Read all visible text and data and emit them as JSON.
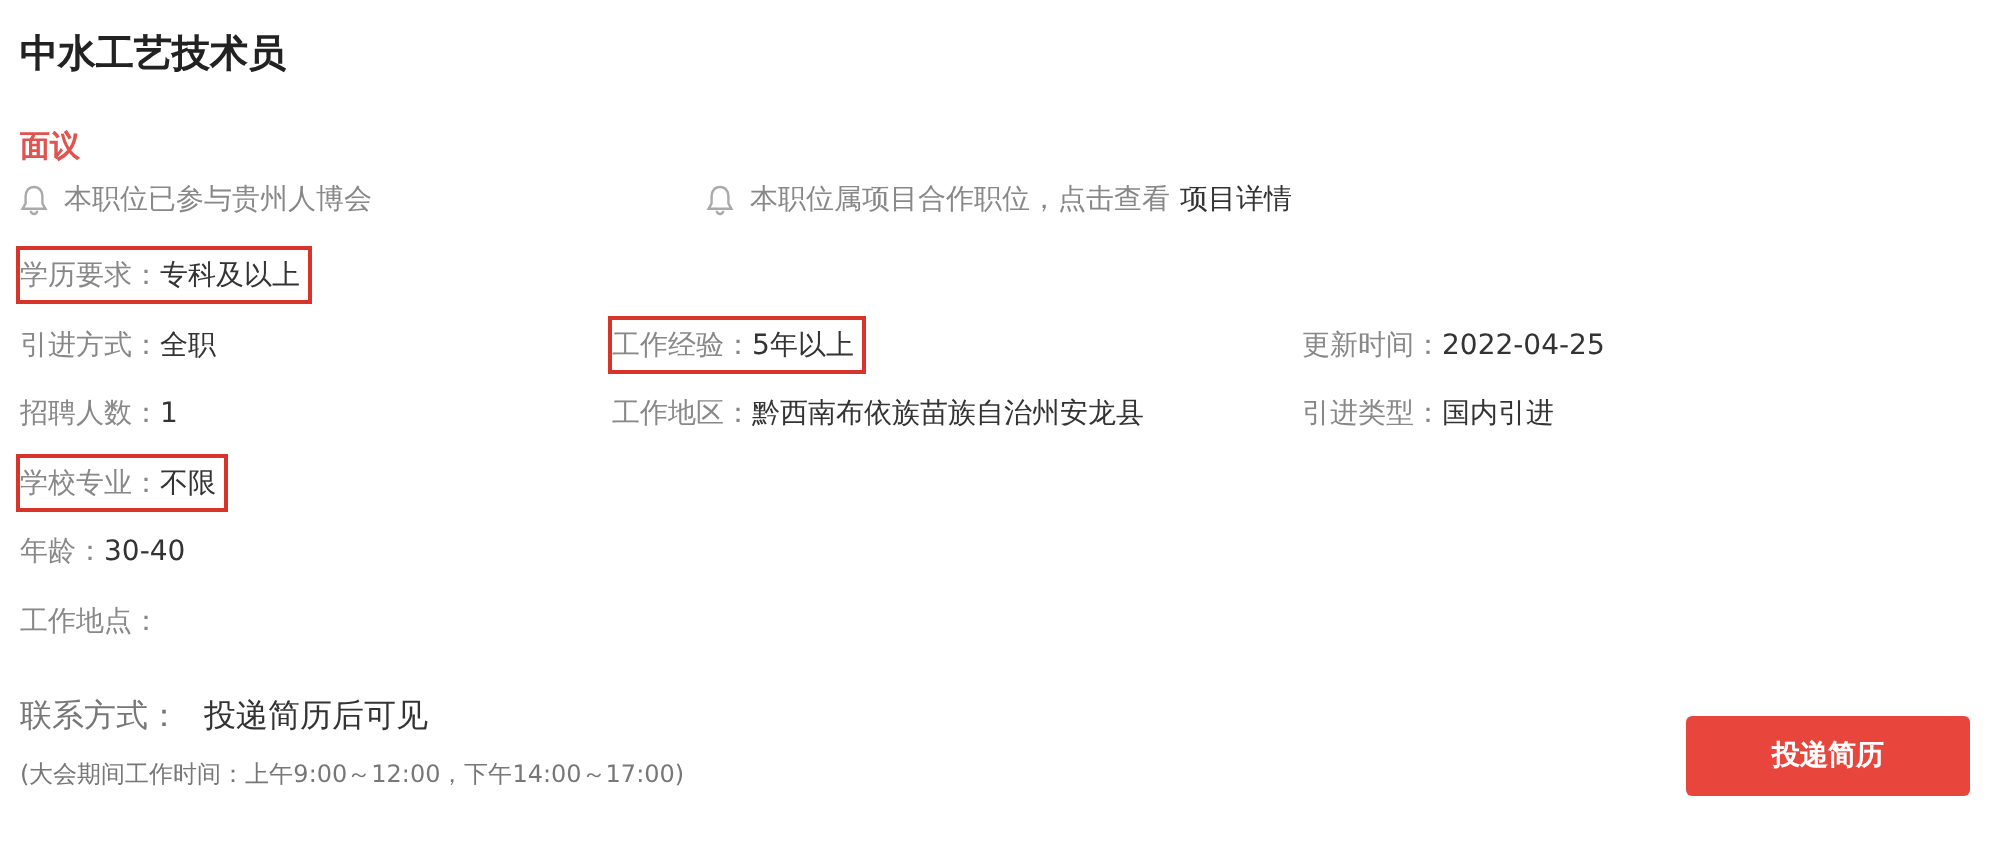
{
  "title": "中水工艺技术员",
  "salary": "面议",
  "notices": [
    {
      "text": "本职位已参与贵州人博会"
    },
    {
      "text": "本职位属项目合作职位，点击查看",
      "link": "项目详情"
    }
  ],
  "fields": [
    [
      {
        "label": "学历要求：",
        "value": "专科及以上",
        "highlighted": true
      }
    ],
    [
      {
        "label": "引进方式：",
        "value": "全职",
        "highlighted": false
      },
      {
        "label": "工作经验：",
        "value": "5年以上",
        "highlighted": true
      },
      {
        "label": "更新时间：",
        "value": "2022-04-25",
        "highlighted": false
      }
    ],
    [
      {
        "label": "招聘人数：",
        "value": "1",
        "highlighted": false
      },
      {
        "label": "工作地区：",
        "value": "黔西南布依族苗族自治州安龙县",
        "highlighted": false
      },
      {
        "label": "引进类型：",
        "value": "国内引进",
        "highlighted": false
      }
    ],
    [
      {
        "label": "学校专业：",
        "value": "不限",
        "highlighted": true
      }
    ],
    [
      {
        "label": "年龄：",
        "value": "30-40",
        "highlighted": false
      }
    ],
    [
      {
        "label": "工作地点：",
        "highlighted": false
      }
    ]
  ],
  "contact": {
    "label": "联系方式：",
    "value": "投递简历后可见"
  },
  "hours": "(大会期间工作时间：上午9:00～12:00，下午14:00～17:00)",
  "apply_button": "投递简历"
}
